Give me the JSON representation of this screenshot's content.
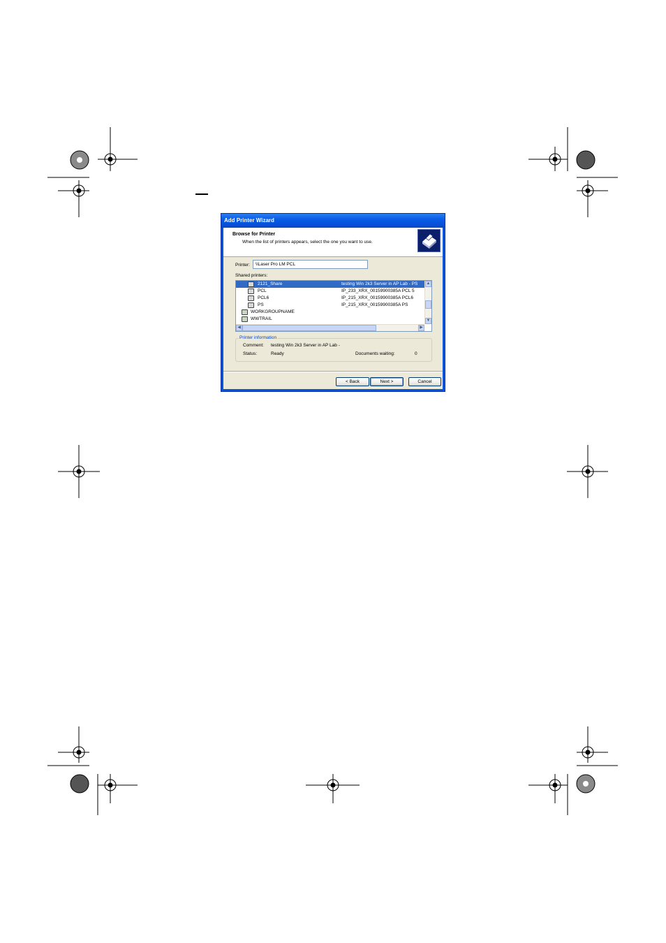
{
  "dialog": {
    "title": "Add Printer Wizard",
    "header_title": "Browse for Printer",
    "header_subtitle": "When the list of printers appears, select the one you want to use.",
    "printer_label": "Printer:",
    "printer_value": "\\\\Laser Pro LM PCL",
    "shared_label": "Shared printers:",
    "list": [
      {
        "name": "2121_Share",
        "comment": "testing Win 2k3 Server in AP Lab - PS",
        "icon": "printer-icon",
        "selected": true
      },
      {
        "name": "PCL",
        "comment": "IP_233_XRX_00159900385A PCL 5",
        "icon": "printer-icon",
        "selected": false
      },
      {
        "name": "PCL6",
        "comment": "IP_215_XRX_00159900385A PCL6",
        "icon": "printer-icon",
        "selected": false
      },
      {
        "name": "PS",
        "comment": "IP_215_XRX_00159900385A PS",
        "icon": "printer-icon",
        "selected": false
      },
      {
        "name": "WORKGROUPNAME",
        "comment": "",
        "icon": "workgroup-icon",
        "selected": false
      },
      {
        "name": "WWTRAIL",
        "comment": "",
        "icon": "workgroup-icon",
        "selected": false
      }
    ],
    "info": {
      "legend": "Printer information",
      "comment_label": "Comment:",
      "comment_value": "testing Win 2k3 Server in AP Lab -",
      "status_label": "Status:",
      "status_value": "Ready",
      "docs_label": "Documents waiting:",
      "docs_value": "0"
    },
    "buttons": {
      "back": "< Back",
      "next": "Next >",
      "cancel": "Cancel"
    }
  },
  "colors": {
    "title_blue": "#0a5ce6",
    "selection": "#316ac5",
    "face": "#ece9d8"
  }
}
